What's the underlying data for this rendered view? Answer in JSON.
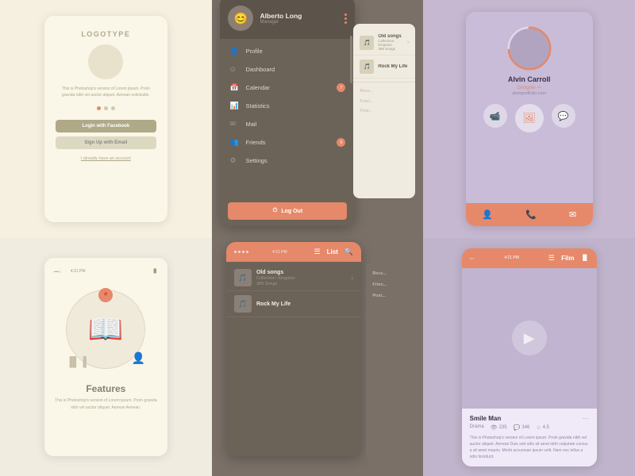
{
  "app": {
    "title": "Rock My Life"
  },
  "login": {
    "logo": "LOGOTYPE",
    "body_text": "This is Photoshop's version of Lorem ipsum. Proin gravida nibh vel auctor aliquet. Aenean solicitudin.",
    "btn_facebook": "Login with Facebook",
    "btn_email": "Sign Up with Email",
    "link": "I already have an account"
  },
  "menu": {
    "user_name": "Alberto Long",
    "user_role": "Manager",
    "items": [
      {
        "icon": "👤",
        "label": "Profile",
        "badge": null
      },
      {
        "icon": "⚙",
        "label": "Dashboard",
        "badge": null
      },
      {
        "icon": "📅",
        "label": "Calendar",
        "badge": "7"
      },
      {
        "icon": "📊",
        "label": "Statistics",
        "badge": null
      },
      {
        "icon": "✉",
        "label": "Mail",
        "badge": null
      },
      {
        "icon": "👥",
        "label": "Friends",
        "badge": "6"
      },
      {
        "icon": "⚙",
        "label": "Settings",
        "badge": null
      }
    ],
    "logout": "Log Out"
  },
  "profile": {
    "name": "Alvin Carroll",
    "role": "Designer ✏",
    "site": "alvinportfolio.com"
  },
  "songs": {
    "items": [
      {
        "title": "Old songs",
        "subtitle": "Collection: Kingston",
        "count": "389 Songs"
      },
      {
        "title": "Rock My Life",
        "subtitle": "",
        "count": ""
      }
    ]
  },
  "features": {
    "time": "4:21 PM",
    "title": "Features",
    "body": "This is Photoshop's version of Lorem ipsum. Proin\ngravida nibh vel auctor aliquet.\nAenean Aenean."
  },
  "list_screen": {
    "time": "4:21 PM",
    "title": "List",
    "items": [
      {
        "title": "Old songs",
        "subtitle": "Collection: Kingston · 389 Songs"
      },
      {
        "title": "Rock My Life",
        "subtitle": ""
      }
    ],
    "sections": [
      "Rece...",
      "Frien...",
      "Post..."
    ]
  },
  "video_screen": {
    "time": "4:21 PM",
    "title": "Film",
    "movie_title": "Smile Man",
    "genre": "Drama",
    "views": "235",
    "comments": "346",
    "rating": "4.5",
    "description": "This is Photoshop's version of Lorem ipsum. Proin gravida nibh vel auctor aliquet. Aenean\nDuis sed odio sit amet nibh vulputate cursus a sit amet mauris.\nMorbi accumsan ipsum velit. Nam nec tellus a odio tincidunt."
  }
}
